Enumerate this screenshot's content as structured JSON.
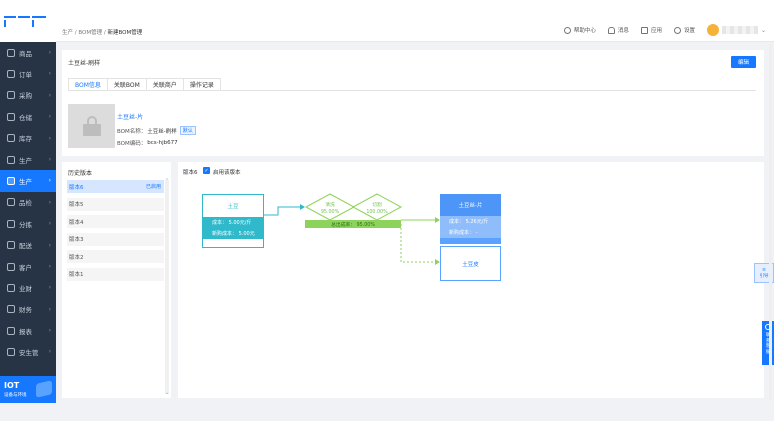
{
  "sidebar": {
    "items": [
      {
        "label": "商品"
      },
      {
        "label": "订单"
      },
      {
        "label": "采购"
      },
      {
        "label": "仓储"
      },
      {
        "label": "库存"
      },
      {
        "label": "生产"
      },
      {
        "label": "生产"
      },
      {
        "label": "品检"
      },
      {
        "label": "分拣"
      },
      {
        "label": "配送"
      },
      {
        "label": "客户"
      },
      {
        "label": "业财"
      },
      {
        "label": "财务"
      },
      {
        "label": "报表"
      },
      {
        "label": "安生管"
      }
    ],
    "active_index": 6,
    "iot": {
      "title": "IOT",
      "subtitle": "设备与环境"
    }
  },
  "header": {
    "breadcrumb": [
      "生产",
      "BOM管理",
      "新建BOM管理"
    ],
    "tools": [
      {
        "icon": "help-icon",
        "label": "帮助中心"
      },
      {
        "icon": "bell-icon",
        "label": "消息"
      },
      {
        "icon": "app-icon",
        "label": "应用"
      },
      {
        "icon": "gear-icon",
        "label": "设置"
      }
    ]
  },
  "page": {
    "title": "土豆丝-刷样",
    "edit_label": "编辑",
    "tabs": [
      "BOM信息",
      "关联BOM",
      "关联商户",
      "操作记录"
    ],
    "active_tab": 0,
    "product": {
      "name": "土豆丝-片",
      "bom_name_label": "BOM名称：",
      "bom_name": "土豆丝-刷样",
      "default_tag": "默认",
      "bom_code_label": "BOM编码：",
      "bom_code": "bcs-hjb677"
    }
  },
  "history": {
    "title": "历史版本",
    "items": [
      {
        "label": "版本6",
        "status": "已启用"
      },
      {
        "label": "版本5",
        "status": ""
      },
      {
        "label": "版本4",
        "status": ""
      },
      {
        "label": "版本3",
        "status": ""
      },
      {
        "label": "版本2",
        "status": ""
      },
      {
        "label": "版本1",
        "status": ""
      }
    ]
  },
  "flow": {
    "version_label": "版本6",
    "checkbox_label": "启用该版本",
    "source": {
      "title": "土豆",
      "cost": "成本： 5.00元/斤",
      "price": "新购成本： 5.00元"
    },
    "step1": {
      "name": "清洗",
      "rate": "95.00%"
    },
    "step2": {
      "name": "切割",
      "rate": "100.00%"
    },
    "total_rate": "总出成率： 95.00%",
    "output": {
      "title": "土豆丝-片",
      "cost": "成本： 5.26元/斤",
      "price": "新购成本： -"
    },
    "byproduct": {
      "title": "土豆皮"
    }
  },
  "floats": {
    "guide": "引导",
    "service": [
      "联",
      "系",
      "客",
      "服"
    ]
  },
  "colors": {
    "primary": "#1677ff",
    "sidebar": "#263445",
    "source_node": "#2fb9cb",
    "green": "#8dd35b"
  }
}
